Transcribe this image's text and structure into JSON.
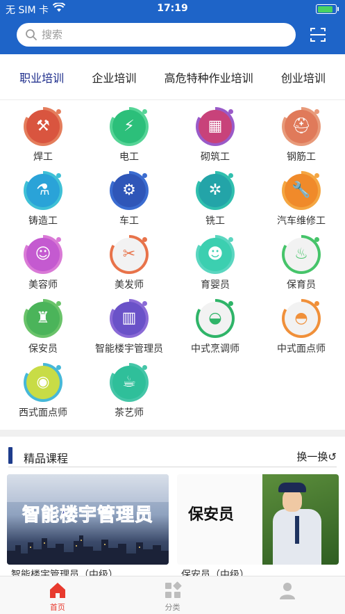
{
  "status_bar": {
    "carrier": "无 SIM 卡",
    "time": "17:19",
    "battery_level": 0.9,
    "battery_color": "#48d262"
  },
  "header": {
    "background": "#1e64c8",
    "search_placeholder": "搜索"
  },
  "category_tabs": [
    {
      "label": "职业培训",
      "active": true
    },
    {
      "label": "企业培训",
      "active": false
    },
    {
      "label": "高危特种作业培训",
      "active": false
    },
    {
      "label": "创业培训",
      "active": false
    }
  ],
  "jobs": [
    {
      "label": "焊工",
      "icon": "welder-icon",
      "glyph": "⚒",
      "color": "#d9553f",
      "ring": "#e47d5c"
    },
    {
      "label": "电工",
      "icon": "plug-icon",
      "glyph": "⚡",
      "color": "#2cbf7a",
      "ring": "#55d496"
    },
    {
      "label": "砌筑工",
      "icon": "bricklayer-icon",
      "glyph": "▦",
      "color": "#c8427a",
      "ring": "#9a5ac8"
    },
    {
      "label": "钢筋工",
      "icon": "rebar-worker-icon",
      "glyph": "⛑",
      "color": "#e07a5a",
      "ring": "#e89a7a"
    },
    {
      "label": "铸造工",
      "icon": "casting-icon",
      "glyph": "⚗",
      "color": "#2aa3d8",
      "ring": "#3fc0d6"
    },
    {
      "label": "车工",
      "icon": "lathe-icon",
      "glyph": "⚙",
      "color": "#2f56b8",
      "ring": "#3b6cd0"
    },
    {
      "label": "铣工",
      "icon": "milling-icon",
      "glyph": "✲",
      "color": "#23a4a8",
      "ring": "#30bfae"
    },
    {
      "label": "汽车维修工",
      "icon": "car-repair-icon",
      "glyph": "🔧",
      "color": "#f08a2a",
      "ring": "#f4a642"
    },
    {
      "label": "美容师",
      "icon": "beautician-icon",
      "glyph": "☺",
      "color": "#c45ad0",
      "ring": "#d97ad6"
    },
    {
      "label": "美发师",
      "icon": "scissors-icon",
      "glyph": "✂",
      "color": "#f2f2f2",
      "ring": "#e8734a"
    },
    {
      "label": "育婴员",
      "icon": "baby-icon",
      "glyph": "☻",
      "color": "#3ccfb0",
      "ring": "#5bd6c0"
    },
    {
      "label": "保育员",
      "icon": "stroller-icon",
      "glyph": "♨",
      "color": "#f2f2f2",
      "ring": "#46c46a"
    },
    {
      "label": "保安员",
      "icon": "security-guard-icon",
      "glyph": "♜",
      "color": "#4bb45a",
      "ring": "#6ac36a"
    },
    {
      "label": "智能楼宇管理员",
      "icon": "building-icon",
      "glyph": "▥",
      "color": "#6a52c8",
      "ring": "#8a6ad6"
    },
    {
      "label": "中式烹调师",
      "icon": "bowl-icon",
      "glyph": "◒",
      "color": "#f2f2f2",
      "ring": "#2fb468"
    },
    {
      "label": "中式面点师",
      "icon": "noodle-bowl-icon",
      "glyph": "◓",
      "color": "#f2f2f2",
      "ring": "#f0903a"
    },
    {
      "label": "西式面点师",
      "icon": "cake-icon",
      "glyph": "◉",
      "color": "#c8dc46",
      "ring": "#46b8d8"
    },
    {
      "label": "茶艺师",
      "icon": "tea-icon",
      "glyph": "☕",
      "color": "#2fbf9a",
      "ring": "#45c6a8"
    }
  ],
  "featured": {
    "title": "精品课程",
    "refresh": "换一换↺",
    "cards": [
      {
        "image_text": "智能楼宇管理员",
        "caption": "智能楼宇管理员（中级）"
      },
      {
        "image_text": "保安员",
        "caption": "保安员（中级）"
      }
    ]
  },
  "tabbar": [
    {
      "label": "首页",
      "icon": "home-icon",
      "active": true,
      "color": "#e83a2e"
    },
    {
      "label": "分类",
      "icon": "category-grid-icon",
      "active": false,
      "color": "#bdbdbd"
    },
    {
      "label": "",
      "icon": "profile-icon",
      "active": false,
      "color": "#bdbdbd"
    }
  ]
}
